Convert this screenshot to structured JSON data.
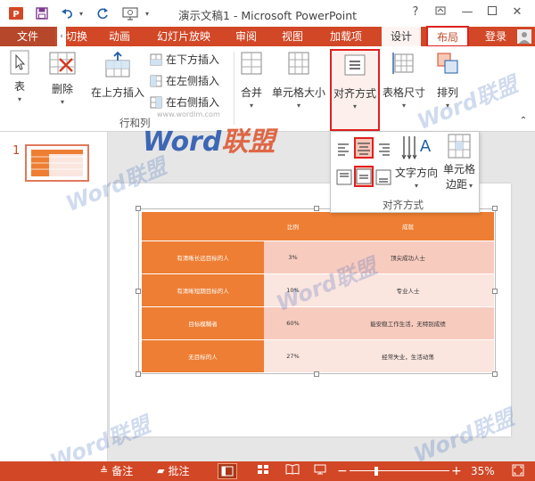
{
  "app": {
    "title": "演示文稿1 - Microsoft PowerPoint",
    "help": "?"
  },
  "tabs": {
    "file": "文件",
    "transitions_partial": "切换",
    "animations": "动画",
    "slideshow": "幻灯片放映",
    "review": "审阅",
    "view": "视图",
    "addins": "加载项",
    "design": "设计",
    "layout": "布局",
    "login": "登录"
  },
  "ribbon": {
    "table": "表",
    "delete": "删除",
    "insert_above": "在上方插入",
    "insert_below": "在下方插入",
    "insert_left": "在左侧插入",
    "insert_right": "在右侧插入",
    "group_rows_cols": "行和列",
    "merge": "合并",
    "cell_size": "单元格大小",
    "alignment": "对齐方式",
    "table_size": "表格尺寸",
    "arrange": "排列"
  },
  "dropdown": {
    "text_direction": "文字方向",
    "cell_margin_1": "单元格",
    "cell_margin_2": "边距",
    "group_label": "对齐方式"
  },
  "thumbnail": {
    "number": "1"
  },
  "table": {
    "header": [
      "",
      "比例",
      "成就"
    ],
    "rows": [
      [
        "有清晰长远目标的人",
        "3%",
        "顶尖成功人士"
      ],
      [
        "有清晰短期目标的人",
        "10%",
        "专业人士"
      ],
      [
        "目标模糊者",
        "60%",
        "能安稳工作生活，无特别成绩"
      ],
      [
        "无目标的人",
        "27%",
        "经常失业，生活动荡"
      ]
    ]
  },
  "watermark": {
    "brand_en": "Word",
    "brand_cn": "联盟",
    "site": "www.wordlm.com"
  },
  "status": {
    "notes": "备注",
    "comments": "批注",
    "zoom_minus": "−",
    "zoom_plus": "+",
    "zoom_level": "35%"
  },
  "colors": {
    "accent": "#d24726",
    "table_orange": "#ee7e33",
    "highlight_box": "#e02020"
  }
}
